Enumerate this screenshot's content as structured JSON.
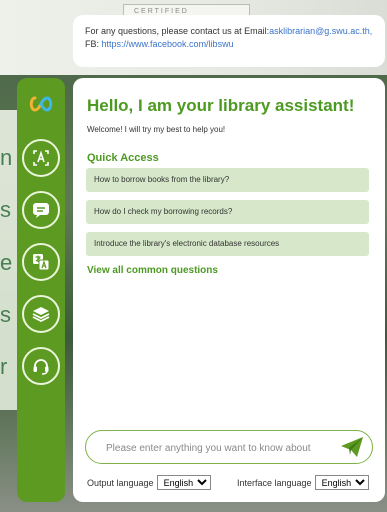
{
  "backdrop": {
    "certified_label": "CERTIFIED",
    "left_letters": [
      "n",
      "s",
      "e",
      "s",
      "r"
    ]
  },
  "info": {
    "text_prefix": "For any questions, please contact us at Email:",
    "email": "asklibrarian@g.swu.ac.th,",
    "fb_label": "FB: ",
    "fb_url": "https://www.facebook.com/libswu"
  },
  "rail": {
    "items": [
      {
        "icon": "logo-icon"
      },
      {
        "icon": "translate-a-icon"
      },
      {
        "icon": "chat-bubble-icon"
      },
      {
        "icon": "language-icon"
      },
      {
        "icon": "books-icon"
      },
      {
        "icon": "headset-icon"
      }
    ]
  },
  "panel": {
    "title": "Hello, I am your library assistant!",
    "welcome": "Welcome! I will try my best to help you!",
    "quick_access_heading": "Quick Access",
    "quick_items": [
      "How to borrow books from the library?",
      "How do I check my borrowing records?",
      "Introduce the library's electronic database resources"
    ],
    "view_all": "View all common questions",
    "input_placeholder": "Please enter anything you want to know about",
    "output_language_label": "Output language",
    "output_language_value": "English",
    "interface_language_label": "Interface language",
    "interface_language_value": "English"
  },
  "colors": {
    "accent_green": "#4d9a22",
    "rail_green": "#5d9a22",
    "quick_item_bg": "#d6e8c9",
    "link_blue": "#3b74c8"
  }
}
